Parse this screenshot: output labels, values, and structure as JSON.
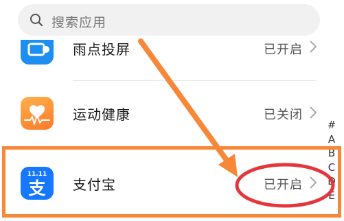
{
  "search": {
    "placeholder": "搜索应用",
    "icon": "search-icon"
  },
  "apps": [
    {
      "name": "雨点投屏",
      "status": "已开启",
      "icon": "cast-app-icon"
    },
    {
      "name": "运动健康",
      "status": "已关闭",
      "icon": "health-app-icon"
    },
    {
      "name": "支付宝",
      "status": "已开启",
      "icon": "alipay-app-icon",
      "badge": "11.11",
      "glyph": "支"
    }
  ],
  "alphabet_index": [
    "#",
    "A",
    "B",
    "C",
    "D",
    "E"
  ],
  "colors": {
    "annotation": "#f7883a",
    "circle": "#e5363c",
    "alipay": "#1677ff",
    "health": "#ff8c36"
  }
}
